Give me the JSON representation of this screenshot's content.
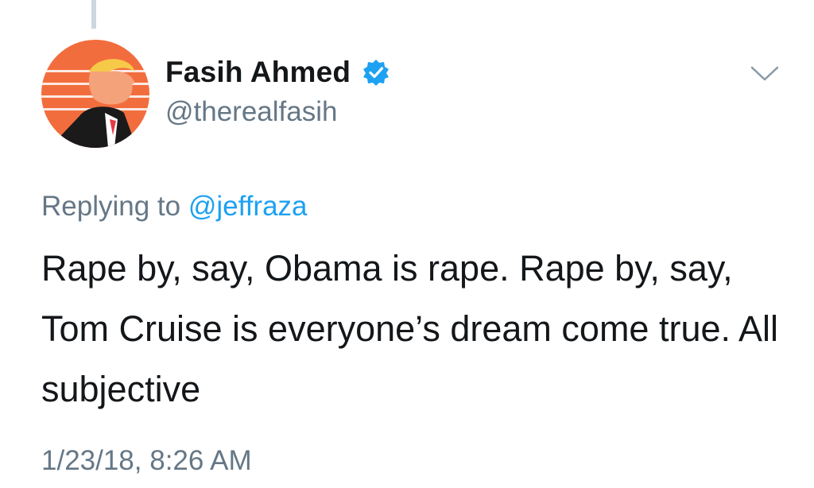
{
  "tweet": {
    "author": {
      "display_name": "Fasih Ahmed",
      "handle": "@therealfasih",
      "verified": true,
      "avatar_icon": "cartoon-portrait-avatar"
    },
    "reply_label": "Replying to",
    "reply_to_handle": "@jeffraza",
    "text": "Rape by, say, Obama is rape. Rape by, say, Tom Cruise is everyone’s dream come true. All subjective",
    "timestamp": "1/23/18, 8:26 AM"
  },
  "icons": {
    "verified": "verified-badge-icon",
    "menu": "chevron-down-icon"
  },
  "colors": {
    "link": "#1da1f2",
    "secondary_text": "#657786",
    "primary_text": "#14171a",
    "avatar_background": "#f26d3d"
  }
}
